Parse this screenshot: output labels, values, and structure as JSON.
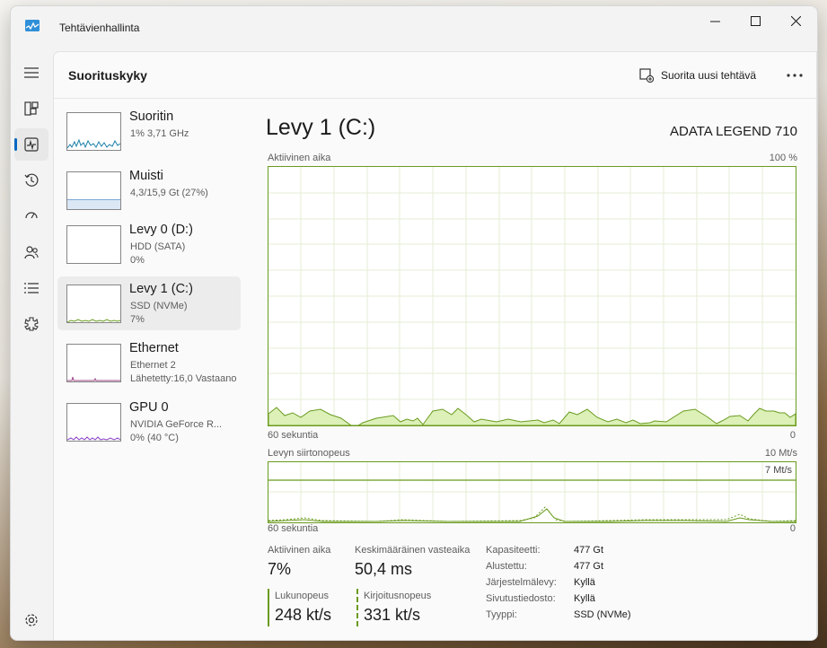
{
  "window": {
    "title": "Tehtävienhallinta"
  },
  "nav": [
    {
      "icon": "hamburger-icon"
    },
    {
      "icon": "processes-icon"
    },
    {
      "icon": "performance-icon"
    },
    {
      "icon": "app-history-icon"
    },
    {
      "icon": "startup-apps-icon"
    },
    {
      "icon": "users-icon"
    },
    {
      "icon": "details-icon"
    },
    {
      "icon": "services-icon"
    },
    {
      "icon": "settings-icon"
    }
  ],
  "header": {
    "title": "Suorituskyky",
    "run_task": "Suorita uusi tehtävä"
  },
  "devices": [
    {
      "name": "Suoritin",
      "line2": "1% 3,71 GHz",
      "line3": ""
    },
    {
      "name": "Muisti",
      "line2": "4,3/15,9 Gt (27%)",
      "line3": ""
    },
    {
      "name": "Levy 0 (D:)",
      "line2": "HDD (SATA)",
      "line3": "0%"
    },
    {
      "name": "Levy 1 (C:)",
      "line2": "SSD (NVMe)",
      "line3": "7%"
    },
    {
      "name": "Ethernet",
      "line2": "Ethernet 2",
      "line3": "Lähetetty:16,0 Vastaano"
    },
    {
      "name": "GPU 0",
      "line2": "NVIDIA GeForce R...",
      "line3": "0% (40 °C)"
    }
  ],
  "detail": {
    "title": "Levy 1 (C:)",
    "model": "ADATA LEGEND 710",
    "active_time_label": "Aktiivinen aika",
    "active_time_max": "100 %",
    "time_left": "60 sekuntia",
    "time_right": "0",
    "transfer_label": "Levyn siirtonopeus",
    "transfer_max": "10 Mt/s",
    "transfer_line": "7 Mt/s",
    "time_left2": "60 sekuntia",
    "time_right2": "0"
  },
  "stats": {
    "active_time_label": "Aktiivinen aika",
    "active_time_value": "7%",
    "response_label": "Keskimääräinen vasteaika",
    "response_value": "50,4 ms",
    "read_label": "Lukunopeus",
    "read_value": "248 kt/s",
    "write_label": "Kirjoitusnopeus",
    "write_value": "331 kt/s"
  },
  "properties": [
    {
      "key": "Kapasiteetti:",
      "value": "477 Gt"
    },
    {
      "key": "Alustettu:",
      "value": "477 Gt"
    },
    {
      "key": "Järjestelmälevy:",
      "value": "Kyllä"
    },
    {
      "key": "Sivutustiedosto:",
      "value": "Kyllä"
    },
    {
      "key": "Tyyppi:",
      "value": "SSD (NVMe)"
    }
  ],
  "colors": {
    "disk_accent": "#6a9b1f",
    "disk_fill": "#dcf0b8",
    "cpu": "#1b7fa8",
    "memory": "#7ba7d6",
    "gpu": "#8a3fc4",
    "ethernet": "#a04a8a"
  }
}
